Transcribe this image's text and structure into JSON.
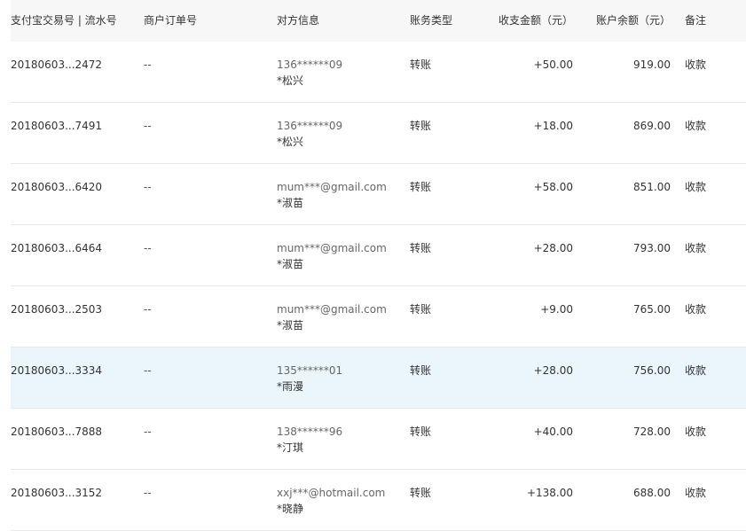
{
  "headers": {
    "trade_no": "支付宝交易号 | 流水号",
    "order_no": "商户订单号",
    "counterparty": "对方信息",
    "type": "账务类型",
    "amount": "收支金额（元）",
    "balance": "账户余额（元）",
    "note": "备注"
  },
  "rows": [
    {
      "trade_no": "20180603...2472",
      "order_no": "--",
      "account": "136******09",
      "name": "*松兴",
      "type": "转账",
      "amount": "+50.00",
      "balance": "919.00",
      "note": "收款"
    },
    {
      "trade_no": "20180603...7491",
      "order_no": "--",
      "account": "136******09",
      "name": "*松兴",
      "type": "转账",
      "amount": "+18.00",
      "balance": "869.00",
      "note": "收款"
    },
    {
      "trade_no": "20180603...6420",
      "order_no": "--",
      "account": "mum***@gmail.com",
      "name": "*淑苗",
      "type": "转账",
      "amount": "+58.00",
      "balance": "851.00",
      "note": "收款"
    },
    {
      "trade_no": "20180603...6464",
      "order_no": "--",
      "account": "mum***@gmail.com",
      "name": "*淑苗",
      "type": "转账",
      "amount": "+28.00",
      "balance": "793.00",
      "note": "收款"
    },
    {
      "trade_no": "20180603...2503",
      "order_no": "--",
      "account": "mum***@gmail.com",
      "name": "*淑苗",
      "type": "转账",
      "amount": "+9.00",
      "balance": "765.00",
      "note": "收款"
    },
    {
      "trade_no": "20180603...3334",
      "order_no": "--",
      "account": "135******01",
      "name": "*雨漫",
      "type": "转账",
      "amount": "+28.00",
      "balance": "756.00",
      "note": "收款"
    },
    {
      "trade_no": "20180603...7888",
      "order_no": "--",
      "account": "138******96",
      "name": "*汀琪",
      "type": "转账",
      "amount": "+40.00",
      "balance": "728.00",
      "note": "收款"
    },
    {
      "trade_no": "20180603...3152",
      "order_no": "--",
      "account": "xxj***@hotmail.com",
      "name": "*晓静",
      "type": "转账",
      "amount": "+138.00",
      "balance": "688.00",
      "note": "收款"
    }
  ],
  "highlighted_row": 5,
  "colors": {
    "header_bg": "#f7f7f7",
    "highlight_bg": "#eaf5fc",
    "divider": "#e8e8e8",
    "text": "#333333"
  }
}
